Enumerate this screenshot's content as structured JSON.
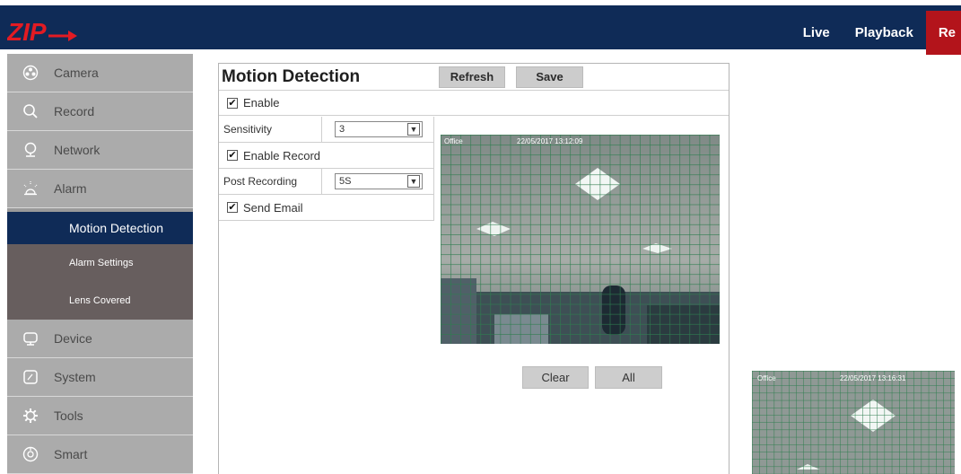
{
  "logo": {
    "text": "ZIP"
  },
  "topnav": {
    "items": [
      {
        "label": "Live"
      },
      {
        "label": "Playback"
      },
      {
        "label": "Re"
      }
    ]
  },
  "sidebar": {
    "items": [
      {
        "label": "Camera",
        "icon": "camera-icon"
      },
      {
        "label": "Record",
        "icon": "search-icon"
      },
      {
        "label": "Network",
        "icon": "network-icon"
      },
      {
        "label": "Alarm",
        "icon": "alarm-icon"
      }
    ],
    "subitems": [
      {
        "label": "Motion Detection"
      },
      {
        "label": "Alarm Settings"
      },
      {
        "label": "Lens Covered"
      }
    ],
    "items_after": [
      {
        "label": "Device",
        "icon": "device-icon"
      },
      {
        "label": "System",
        "icon": "system-icon"
      },
      {
        "label": "Tools",
        "icon": "tools-icon"
      },
      {
        "label": "Smart",
        "icon": "smart-icon"
      }
    ]
  },
  "panel": {
    "title": "Motion Detection",
    "refresh_label": "Refresh",
    "save_label": "Save",
    "enable_label": "Enable",
    "enable_checked": true,
    "sensitivity_label": "Sensitivity",
    "sensitivity_value": "3",
    "enable_record_label": "Enable Record",
    "enable_record_checked": true,
    "post_recording_label": "Post Recording",
    "post_recording_value": "5S",
    "send_email_label": "Send Email",
    "send_email_checked": true,
    "clear_label": "Clear",
    "all_label": "All"
  },
  "preview": {
    "channel": "Office",
    "timestamp": "22/05/2017 13:12:09"
  },
  "preview2": {
    "channel": "Office",
    "timestamp": "22/05/2017 13:16:31"
  },
  "colors": {
    "topbar": "#0f2b57",
    "active_nav": "#b3141b",
    "sidebar": "#ababab",
    "submenu": "#675e5e",
    "grid": "#2e7d4f"
  }
}
